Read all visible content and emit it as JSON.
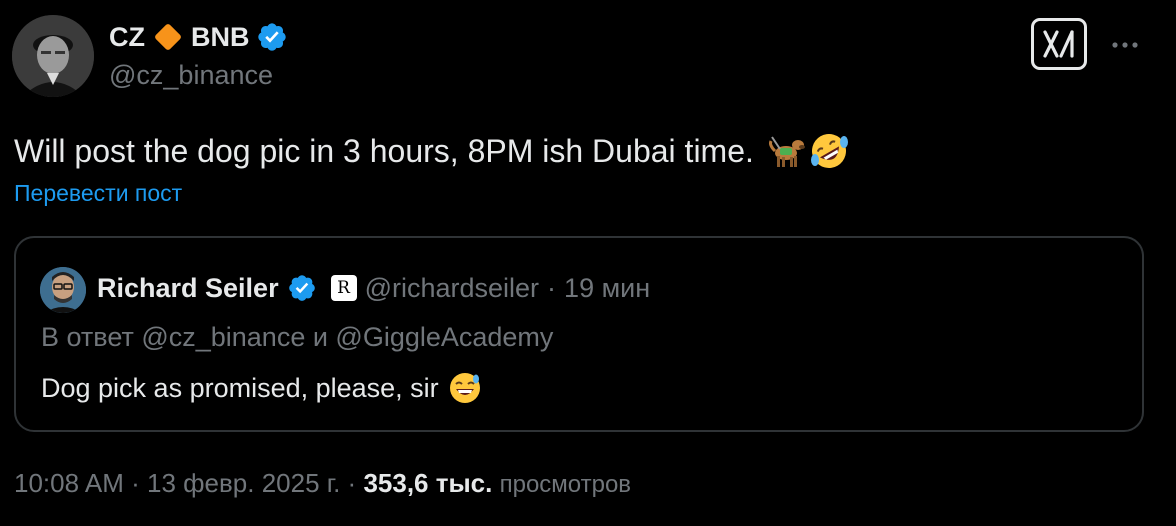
{
  "author": {
    "name": "CZ",
    "name_suffix": "BNB",
    "handle": "@cz_binance",
    "verified_color": "#1d9bf0",
    "diamond_color": "#f7931a"
  },
  "tweet": {
    "text": "Will post the dog pic in 3 hours, 8PM ish Dubai time.",
    "emojis": [
      "🐕‍🦺",
      "🤣"
    ],
    "translate_label": "Перевести пост"
  },
  "quote": {
    "name": "Richard Seiler",
    "affiliate_badge": "R",
    "handle": "@richardseiler",
    "separator": "·",
    "time": "19 мин",
    "reply_to": "В ответ @cz_binance и @GiggleAcademy",
    "text": "Dog pick as promised, please, sir",
    "emoji": "😅"
  },
  "footer": {
    "time": "10:08 AM",
    "sep1": "·",
    "date": "13 февр. 2025 г.",
    "sep2": "·",
    "views_count": "353,6 тыс.",
    "views_label": "просмотров"
  },
  "icons": {
    "grok": "grok-icon",
    "more": "more-icon",
    "verified": "verified-badge-icon",
    "diamond": "diamond-icon"
  }
}
